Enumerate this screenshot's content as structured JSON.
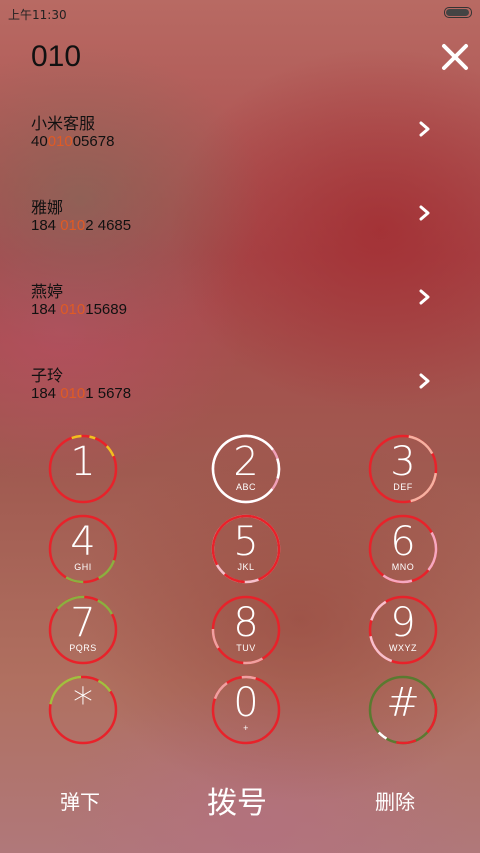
{
  "status": {
    "time": "上午11:30",
    "battery_level": 0.9
  },
  "search": {
    "query": "010"
  },
  "contacts": [
    {
      "name": "小米客服",
      "num_before": "40",
      "num_match": "010",
      "num_after": "05678"
    },
    {
      "name": "雅娜",
      "num_before": "184 ",
      "num_match": "010",
      "num_after": "2 4685"
    },
    {
      "name": "燕婷",
      "num_before": "184 ",
      "num_match": "010",
      "num_after": "15689"
    },
    {
      "name": "子玲",
      "num_before": "184 ",
      "num_match": "010",
      "num_after": "1 5678"
    }
  ],
  "keypad": [
    {
      "digit": "1",
      "letters": ""
    },
    {
      "digit": "2",
      "letters": "ABC"
    },
    {
      "digit": "3",
      "letters": "DEF"
    },
    {
      "digit": "4",
      "letters": "GHI"
    },
    {
      "digit": "5",
      "letters": "JKL"
    },
    {
      "digit": "6",
      "letters": "MNO"
    },
    {
      "digit": "7",
      "letters": "PQRS"
    },
    {
      "digit": "8",
      "letters": "TUV"
    },
    {
      "digit": "9",
      "letters": "WXYZ"
    },
    {
      "digit": "*",
      "letters": ""
    },
    {
      "digit": "0",
      "letters": "+"
    },
    {
      "digit": "#",
      "letters": ""
    }
  ],
  "actions": {
    "hide_label": "弹下",
    "dial_label": "拨号",
    "delete_label": "删除"
  },
  "icons": {
    "close": "close-icon",
    "chevron": "chevron-right-icon"
  },
  "colors": {
    "highlight": "#e05a24",
    "ring_red": "#e8222a"
  }
}
